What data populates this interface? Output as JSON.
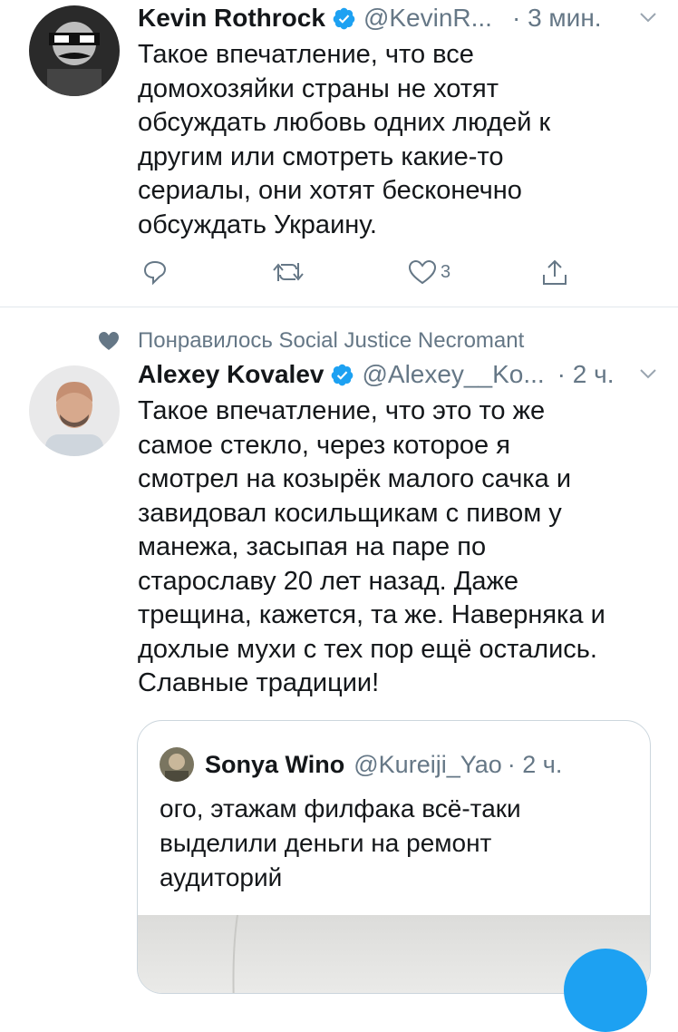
{
  "tweets": [
    {
      "author_name": "Kevin Rothrock",
      "handle": "@KevinR...",
      "time": "· 3 мин.",
      "text": "Такое впечатление, что все\nдомохозяйки страны не хотят\nобсуждать любовь одних людей к\nдругим или смотреть какие-то\nсериалы, они хотят бесконечно\nобсуждать Украину.",
      "like_count": "3",
      "icons": [
        "reply-icon",
        "retweet-icon",
        "like-icon",
        "share-icon"
      ]
    },
    {
      "social_context": "Понравилось Social Justice Necromant",
      "author_name": "Alexey Kovalev",
      "handle": "@Alexey__Ko...",
      "time": "· 2 ч.",
      "text": "Такое впечатление, что это то же\nсамое стекло, через которое я\nсмотрел на козырёк малого сачка и\nзавидовал косильщикам с пивом у\nманежа, засыпая на паре по\nстарославу 20 лет назад. Даже\nтрещина, кажется, та же. Наверняка и\nдохлые мухи с тех пор ещё остались.\nСлавные традиции!",
      "quoted": {
        "author_name": "Sonya Wino",
        "handle": "@Kureiji_Yao",
        "time": "· 2 ч.",
        "text": "ого, этажам филфака всё-таки\nвыделили деньги на ремонт\nаудиторий"
      }
    }
  ],
  "colors": {
    "accent": "#1da1f2",
    "secondary_text": "#657786",
    "border": "#e1e8ed"
  }
}
